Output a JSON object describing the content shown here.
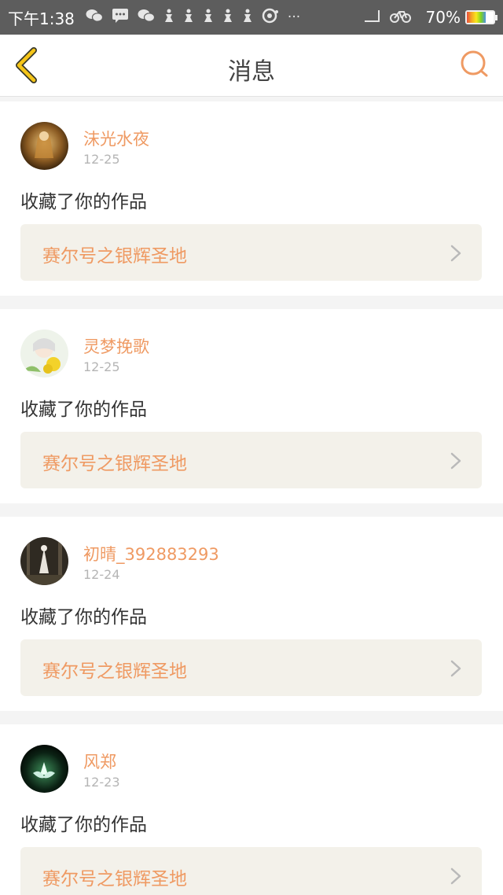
{
  "status_bar": {
    "time": "下午1:38",
    "icons": [
      "wechat-icon",
      "sms-icon",
      "wechat-icon",
      "notification-icon",
      "notification-icon",
      "notification-icon",
      "notification-icon",
      "notification-icon",
      "app-icon",
      "more-dots"
    ],
    "overflow": "···",
    "battery_text": "70%",
    "battery_level": 0.7
  },
  "header": {
    "title": "消息"
  },
  "colors": {
    "accent": "#ef9a63",
    "back_arrow": "#f5c518",
    "status_bar": "#5d5d5d"
  },
  "messages": [
    {
      "name": "沫光水夜",
      "date": "12-25",
      "action": "收藏了你的作品",
      "work": "赛尔号之银辉圣地"
    },
    {
      "name": "灵梦挽歌",
      "date": "12-25",
      "action": "收藏了你的作品",
      "work": "赛尔号之银辉圣地"
    },
    {
      "name": "初晴_392883293",
      "date": "12-24",
      "action": "收藏了你的作品",
      "work": "赛尔号之银辉圣地"
    },
    {
      "name": "风郑",
      "date": "12-23",
      "action": "收藏了你的作品",
      "work": "赛尔号之银辉圣地"
    }
  ]
}
